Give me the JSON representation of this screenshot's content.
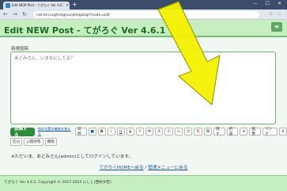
{
  "browser": {
    "tab_title": "Edit NEW Post - てがろぐ Ver 4.6.1",
    "tab_close": "×",
    "new_tab": "+",
    "window_controls": "— ☐ ✕",
    "back": "←",
    "forward": "→",
    "reload": "↻",
    "url": "nishishi.org/testground/tegalog/?mode=edit",
    "ext_icons": "☆ ⋮"
  },
  "header": {
    "title": "Edit NEW Post - てがろぐ Ver 4.6.1",
    "menu_icon": "≡"
  },
  "form": {
    "section_label": "新規投稿",
    "placeholder": "あどみさん、いまなにしてる？",
    "post_button": "投稿する",
    "link_label": "他の位置の機能を使える",
    "toolbar_buttons": [
      "日時",
      "■",
      "B",
      "I",
      "U",
      "S",
      "P",
      "中",
      "大",
      "小",
      "ル",
      "文",
      "色",
      "隠",
      "隠す",
      "折畳",
      "※",
      "画像",
      "リンク",
      "#"
    ],
    "toolbar_row2": [
      "区分",
      "公開状態",
      "機能"
    ]
  },
  "login_message": "※ただいま、あどみさん(admin)としてログインしています。",
  "links": {
    "home": "てがろぐHOMEへ戻る",
    "separator": " / ",
    "admin": "管理メニューに戻る"
  },
  "footer": {
    "text": "てがろぐ Ver 4.6.1, Copyright © 2017-2025 にしし(西村文宏)."
  },
  "colors": {
    "accent": "#2f8b36",
    "header_bg": "#c5efc0",
    "arrow": "#f5f200"
  }
}
